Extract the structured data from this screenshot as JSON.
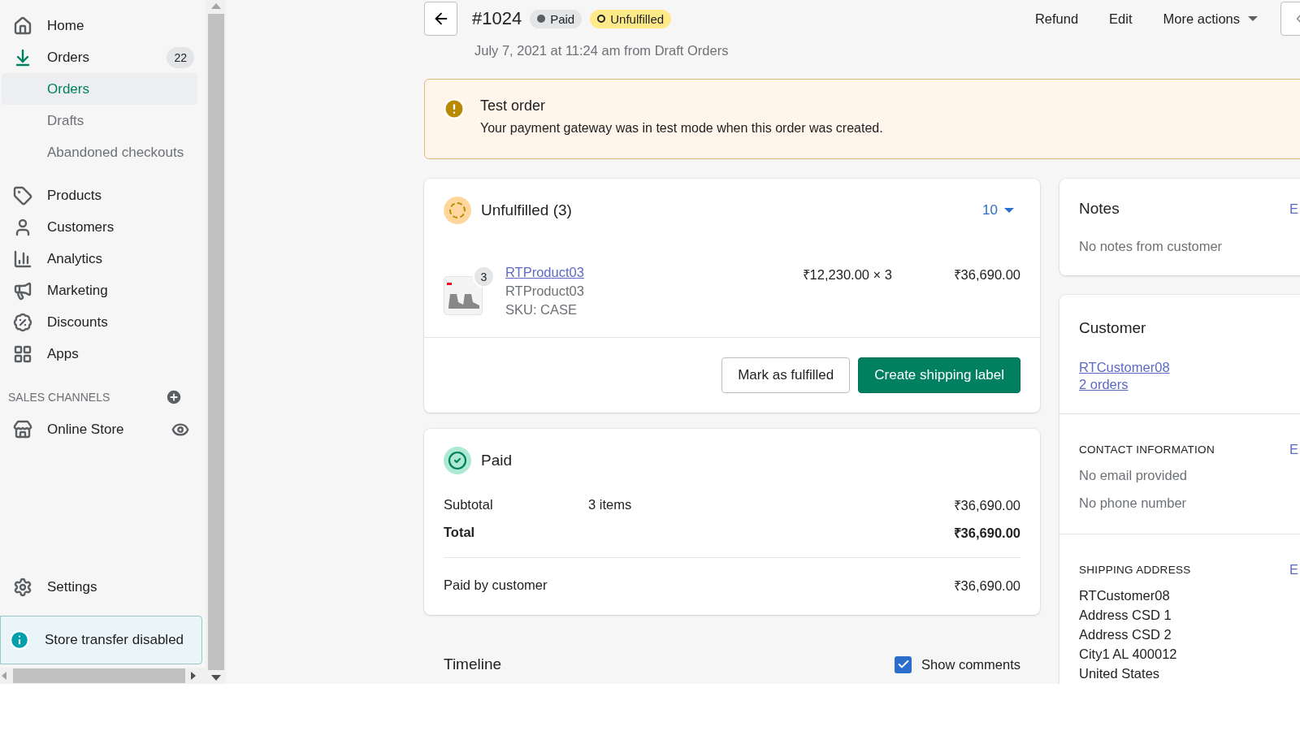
{
  "sidebar": {
    "items": [
      {
        "label": "Home",
        "kind": "main",
        "selected": false
      },
      {
        "label": "Orders",
        "kind": "main",
        "selected": true,
        "badge": "22"
      },
      {
        "label": "Orders",
        "kind": "sub",
        "selected": true
      },
      {
        "label": "Drafts",
        "kind": "sub",
        "selected": false
      },
      {
        "label": "Abandoned checkouts",
        "kind": "sub",
        "selected": false
      },
      {
        "label": "Products",
        "kind": "main",
        "selected": false
      },
      {
        "label": "Customers",
        "kind": "main",
        "selected": false
      },
      {
        "label": "Analytics",
        "kind": "main",
        "selected": false
      },
      {
        "label": "Marketing",
        "kind": "main",
        "selected": false
      },
      {
        "label": "Discounts",
        "kind": "main",
        "selected": false
      },
      {
        "label": "Apps",
        "kind": "main",
        "selected": false
      }
    ],
    "sales_channels": {
      "heading": "SALES CHANNELS",
      "items": [
        {
          "label": "Online Store"
        }
      ]
    },
    "settings": "Settings",
    "notice": "Store transfer disabled"
  },
  "header": {
    "order_number": "#1024",
    "badges": [
      {
        "label": "Paid",
        "kind": "paid"
      },
      {
        "label": "Unfulfilled",
        "kind": "unfulfilled"
      }
    ],
    "subtitle": "July 7, 2021 at 11:24 am from Draft Orders",
    "actions": [
      "Refund",
      "Edit"
    ],
    "more_actions": "More actions"
  },
  "banner": {
    "title": "Test order",
    "message": "Your payment gateway was in test mode when this order was created."
  },
  "fulfillment": {
    "title": "Unfulfilled (3)",
    "location": "10",
    "line_items": [
      {
        "name": "RTProduct03",
        "variant": "RTProduct03",
        "sku": "SKU: CASE",
        "quantity": "3",
        "unit_price": "₹12,230.00 × 3",
        "total": "₹36,690.00"
      }
    ],
    "buttons": [
      {
        "label": "Mark as fulfilled",
        "kind": "secondary"
      },
      {
        "label": "Create shipping label",
        "kind": "primary"
      }
    ]
  },
  "payment": {
    "title": "Paid",
    "rows": [
      {
        "label": "Subtotal",
        "detail": "3 items",
        "amount": "₹36,690.00",
        "kind": "normal"
      },
      {
        "label": "Total",
        "amount": "₹36,690.00",
        "kind": "total"
      }
    ],
    "paid_by": {
      "label": "Paid by customer",
      "amount": "₹36,690.00"
    }
  },
  "timeline": {
    "title": "Timeline",
    "show_comments": {
      "label": "Show comments",
      "checked": true
    }
  },
  "notes": {
    "title": "Notes",
    "edit": "E",
    "text": "No notes from customer"
  },
  "customer": {
    "title": "Customer",
    "name": "RTCustomer08",
    "orders": "2 orders",
    "sections": [
      {
        "heading": "CONTACT INFORMATION",
        "edit": "E",
        "kind": "muted",
        "lines": [
          "No email provided",
          "No phone number"
        ]
      },
      {
        "heading": "SHIPPING ADDRESS",
        "edit": "E",
        "kind": "address",
        "lines": [
          "RTCustomer08",
          "Address CSD 1",
          "Address CSD 2",
          "City1 AL 400012",
          "United States"
        ]
      }
    ]
  }
}
